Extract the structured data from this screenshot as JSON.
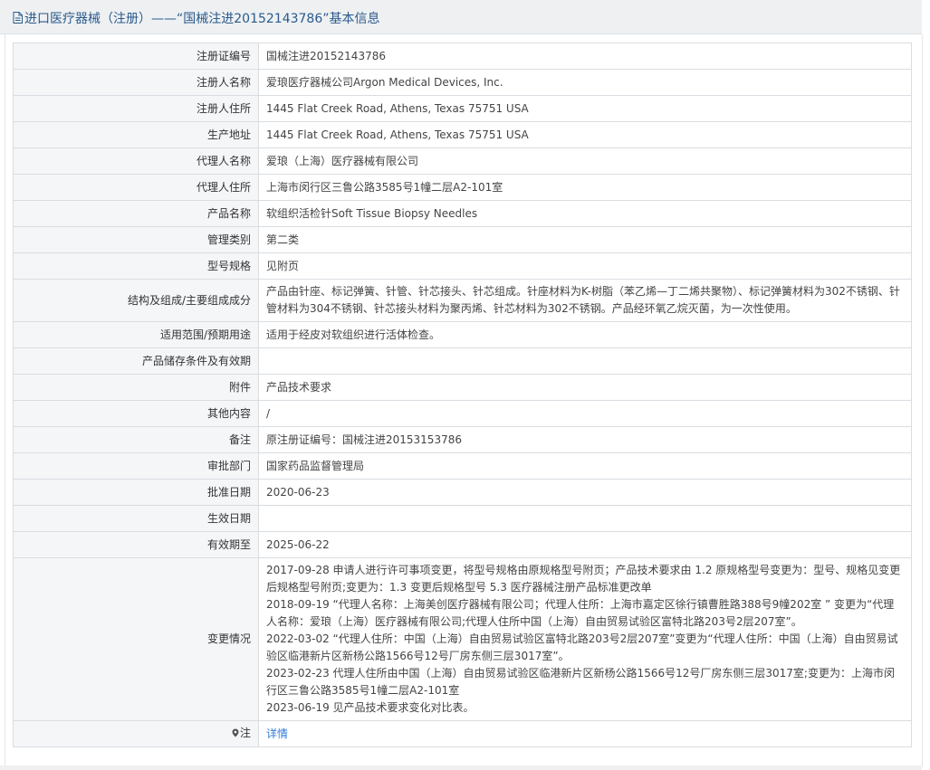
{
  "header": {
    "title": "进口医疗器械（注册）——“国械注进20152143786”基本信息"
  },
  "rows": [
    {
      "label": "注册证编号",
      "value": "国械注进20152143786"
    },
    {
      "label": "注册人名称",
      "value": "爱琅医疗器械公司Argon Medical Devices, Inc."
    },
    {
      "label": "注册人住所",
      "value": "1445 Flat Creek Road, Athens, Texas 75751 USA"
    },
    {
      "label": "生产地址",
      "value": "1445 Flat Creek Road, Athens, Texas 75751 USA"
    },
    {
      "label": "代理人名称",
      "value": "爱琅（上海）医疗器械有限公司"
    },
    {
      "label": "代理人住所",
      "value": "上海市闵行区三鲁公路3585号1幢二层A2-101室"
    },
    {
      "label": "产品名称",
      "value": "软组织活检针Soft Tissue Biopsy Needles"
    },
    {
      "label": "管理类别",
      "value": "第二类"
    },
    {
      "label": "型号规格",
      "value": "见附页"
    },
    {
      "label": "结构及组成/主要组成成分",
      "value": "产品由针座、标记弹簧、针管、针芯接头、针芯组成。针座材料为K-树脂（苯乙烯—丁二烯共聚物）、标记弹簧材料为302不锈钢、针管材料为304不锈钢、针芯接头材料为聚丙烯、针芯材料为302不锈钢。产品经环氧乙烷灭菌，为一次性使用。"
    },
    {
      "label": "适用范围/预期用途",
      "value": "适用于经皮对软组织进行活体检查。"
    },
    {
      "label": "产品储存条件及有效期",
      "value": ""
    },
    {
      "label": "附件",
      "value": "产品技术要求"
    },
    {
      "label": "其他内容",
      "value": "/"
    },
    {
      "label": "备注",
      "value": "原注册证编号：国械注进20153153786"
    },
    {
      "label": "审批部门",
      "value": "国家药品监督管理局"
    },
    {
      "label": "批准日期",
      "value": "2020-06-23"
    },
    {
      "label": "生效日期",
      "value": ""
    },
    {
      "label": "有效期至",
      "value": "2025-06-22"
    }
  ],
  "changes": {
    "label": "变更情况",
    "lines": [
      "2017-09-28 申请人进行许可事项变更，将型号规格由原规格型号附页；产品技术要求由 1.2 原规格型号变更为：型号、规格见变更后规格型号附页;变更为：1.3 变更后规格型号 5.3 医疗器械注册产品标准更改单",
      "2018-09-19 “代理人名称：上海美创医疗器械有限公司；代理人住所：上海市嘉定区徐行镇曹胜路388号9幢202室 ” 变更为“代理人名称：爱琅（上海）医疗器械有限公司;代理人住所中国（上海）自由贸易试验区富特北路203号2层207室”。",
      "2022-03-02 “代理人住所：中国（上海）自由贸易试验区富特北路203号2层207室”变更为“代理人住所：中国（上海）自由贸易试验区临港新片区新杨公路1566号12号厂房东侧三层3017室”。",
      "2023-02-23 代理人住所由中国（上海）自由贸易试验区临港新片区新杨公路1566号12号厂房东侧三层3017室;变更为：上海市闵行区三鲁公路3585号1幢二层A2-101室",
      "2023-06-19 见产品技术要求变化对比表。"
    ]
  },
  "note": {
    "label": "注",
    "link_text": "详情"
  },
  "colors": {
    "title": "#2a5a8c",
    "link": "#2f7bd8",
    "label_bg": "#f5f6f8",
    "border": "#d9dde1"
  }
}
